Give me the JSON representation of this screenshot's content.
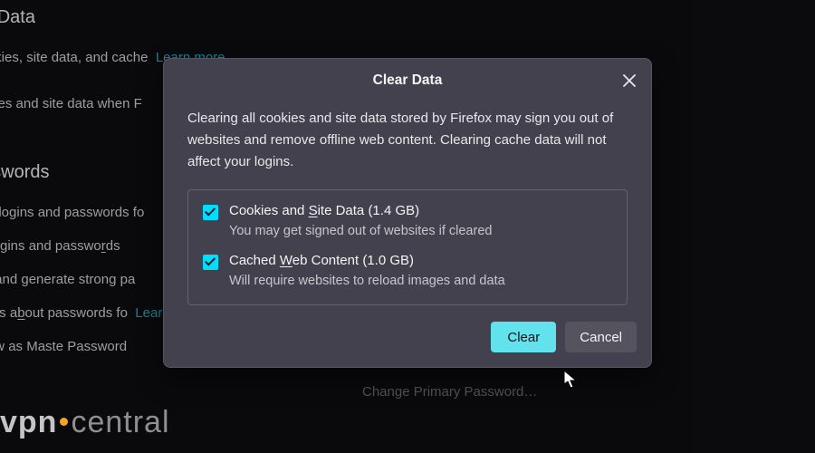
{
  "bg": {
    "section1": {
      "heading": "d Site Data",
      "line1_prefix": "cookies, site data, and cache",
      "learn_more": "Learn more",
      "line2": "ookies and site data when F"
    },
    "section2": {
      "heading": "d Passwords",
      "l1_pre": "ave logins and passwords fo",
      "l2_pre": "fill logins and passwo",
      "l2_u": "r",
      "l2_post": "ds",
      "l3": "est and generate strong pa",
      "l4_pre": "alerts a",
      "l4_u": "b",
      "l4_post": "out passwords fo",
      "l5_link": "Learn more",
      "l6_pre": "know",
      "l6_mid": " as Maste",
      "l6_post": " Password",
      "btn_partial": "Change Primary Password…"
    }
  },
  "modal": {
    "title": "Clear Data",
    "desc": "Clearing all cookies and site data stored by Firefox may sign you out of websites and remove offline web content. Clearing cache data will not affect your logins.",
    "opt1": {
      "checked": true,
      "label_pre": "Cookies and ",
      "label_u": "S",
      "label_post": "ite Data (1.4 GB)",
      "sub": "You may get signed out of websites if cleared"
    },
    "opt2": {
      "checked": true,
      "label_pre": "Cached ",
      "label_u": "W",
      "label_post": "eb Content (1.0 GB)",
      "sub": "Will require websites to reload images and data"
    },
    "clear": "Clear",
    "cancel": "Cancel"
  },
  "watermark": {
    "vpn": "vpn",
    "central": "central"
  }
}
